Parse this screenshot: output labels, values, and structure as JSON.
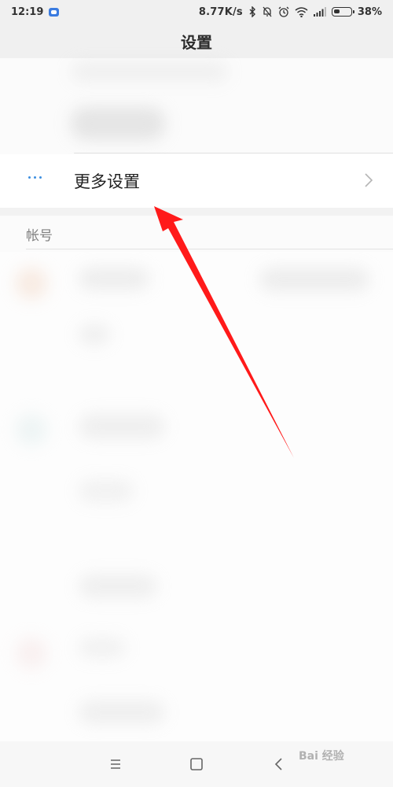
{
  "status_bar": {
    "time": "12:19",
    "network_speed": "8.77K/s",
    "battery_percent": "38%",
    "battery_level": 0.38,
    "icons": [
      "bluetooth-icon",
      "mute-bell-icon",
      "alarm-icon",
      "wifi-icon",
      "signal-icon"
    ]
  },
  "header": {
    "title": "设置"
  },
  "menu": {
    "more_settings": {
      "label": "更多设置",
      "icon": "more-dots-icon"
    }
  },
  "section": {
    "account_header": "帐号"
  },
  "nav": {
    "menu": "menu-icon",
    "home": "home-icon",
    "back": "back-icon"
  },
  "watermark": {
    "text": "Bai 经验"
  },
  "colors": {
    "accent": "#3d8fe0",
    "annotation_arrow": "#ff1a1a"
  }
}
